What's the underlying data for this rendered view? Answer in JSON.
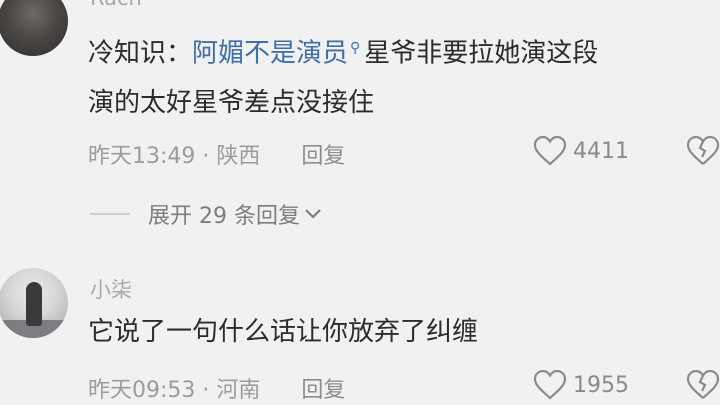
{
  "comments": [
    {
      "username": "Rach",
      "content_prefix": "冷知识：",
      "content_link": "阿媚不是演员",
      "content_suffix": "星爷非要拉她演这段",
      "content_line2": "演的太好星爷差点没接住",
      "time": "昨天13:49",
      "location": "陕西",
      "reply_label": "回复",
      "likes": "4411"
    },
    {
      "username": "小柒",
      "content_line1": "它说了一句什么话让你放弃了纠缠",
      "time": "昨天09:53",
      "location": "河南",
      "reply_label": "回复",
      "likes": "1955"
    }
  ],
  "expand_replies": "展开 29 条回复",
  "icons": {
    "like": "heart-outline-icon",
    "dislike": "broken-heart-icon",
    "expand": "chevron-down-icon",
    "link_search": "search-icon"
  },
  "colors": {
    "link": "#3e6fa8",
    "background": "#f1f1f1"
  }
}
